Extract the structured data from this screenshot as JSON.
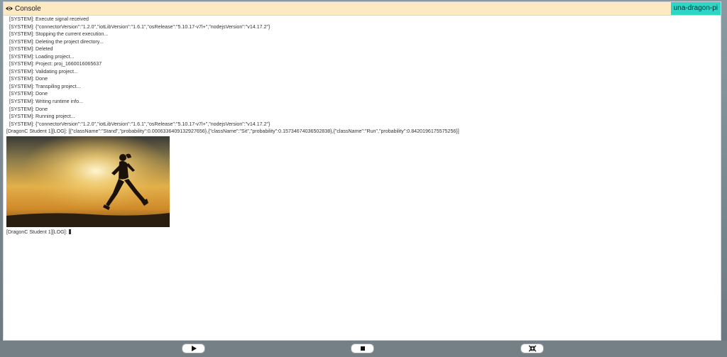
{
  "console": {
    "title": "Console",
    "device_badge": "una-dragon-pi",
    "system_lines": [
      "[SYSTEM]: Execute signal received",
      "[SYSTEM]: {\"connectorVersion\":\"1.2.0\",\"iotLibVersion\":\"1.6.1\",\"osRelease\":\"5.10.17-v7l+\",\"nodejsVersion\":\"v14.17.2\"}",
      "[SYSTEM]: Stopping the current execution...",
      "[SYSTEM]: Deleting the project directory...",
      "[SYSTEM]: Deleted",
      "[SYSTEM]: Loading project...",
      "[SYSTEM]: Project: proj_1660016065637",
      "[SYSTEM]: Validating project...",
      "[SYSTEM]: Done",
      "[SYSTEM]: Transpiling project...",
      "[SYSTEM]: Done",
      "[SYSTEM]: Writing runtime info...",
      "[SYSTEM]: Done",
      "[SYSTEM]: Running project...",
      "[SYSTEM]: {\"connectorVersion\":\"1.2.0\",\"iotLibVersion\":\"1.6.1\",\"osRelease\":\"5.10.17-v7l+\",\"nodejsVersion\":\"v14.17.2\"}"
    ],
    "prediction_line": "[DragonC Student 1][LOG]: [{\"className\":\"Stand\",\"probability\":0.0006336409132927656},{\"className\":\"Sit\",\"probability\":0.15734674036502838},{\"className\":\"Run\",\"probability\":0.8420196175575256}]",
    "last_line": "[DragonC Student 1][LOG]:"
  },
  "controls": {
    "play": "play-icon",
    "stop": "stop-icon",
    "collapse": "collapse-icon"
  },
  "colors": {
    "header_bg": "#fde9c2",
    "badge_bg": "#2fd6c5"
  }
}
